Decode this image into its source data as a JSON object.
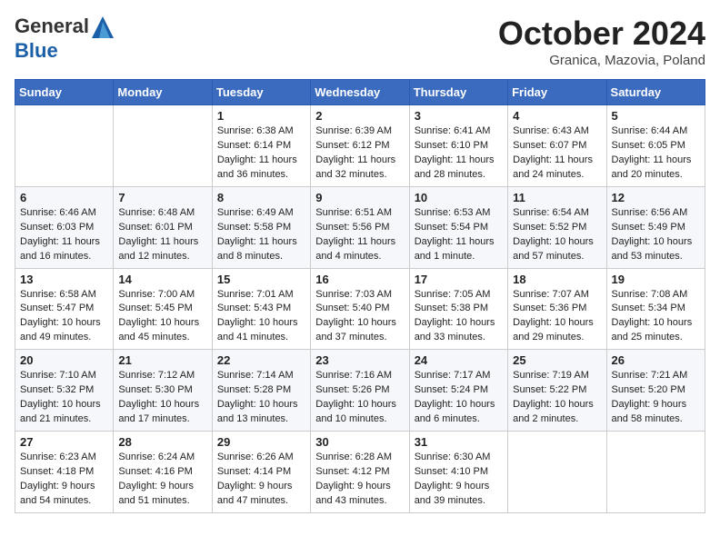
{
  "header": {
    "logo_general": "General",
    "logo_blue": "Blue",
    "month_title": "October 2024",
    "location": "Granica, Mazovia, Poland"
  },
  "days_of_week": [
    "Sunday",
    "Monday",
    "Tuesday",
    "Wednesday",
    "Thursday",
    "Friday",
    "Saturday"
  ],
  "weeks": [
    [
      {
        "day": "",
        "sunrise": "",
        "sunset": "",
        "daylight": ""
      },
      {
        "day": "",
        "sunrise": "",
        "sunset": "",
        "daylight": ""
      },
      {
        "day": "1",
        "sunrise": "Sunrise: 6:38 AM",
        "sunset": "Sunset: 6:14 PM",
        "daylight": "Daylight: 11 hours and 36 minutes."
      },
      {
        "day": "2",
        "sunrise": "Sunrise: 6:39 AM",
        "sunset": "Sunset: 6:12 PM",
        "daylight": "Daylight: 11 hours and 32 minutes."
      },
      {
        "day": "3",
        "sunrise": "Sunrise: 6:41 AM",
        "sunset": "Sunset: 6:10 PM",
        "daylight": "Daylight: 11 hours and 28 minutes."
      },
      {
        "day": "4",
        "sunrise": "Sunrise: 6:43 AM",
        "sunset": "Sunset: 6:07 PM",
        "daylight": "Daylight: 11 hours and 24 minutes."
      },
      {
        "day": "5",
        "sunrise": "Sunrise: 6:44 AM",
        "sunset": "Sunset: 6:05 PM",
        "daylight": "Daylight: 11 hours and 20 minutes."
      }
    ],
    [
      {
        "day": "6",
        "sunrise": "Sunrise: 6:46 AM",
        "sunset": "Sunset: 6:03 PM",
        "daylight": "Daylight: 11 hours and 16 minutes."
      },
      {
        "day": "7",
        "sunrise": "Sunrise: 6:48 AM",
        "sunset": "Sunset: 6:01 PM",
        "daylight": "Daylight: 11 hours and 12 minutes."
      },
      {
        "day": "8",
        "sunrise": "Sunrise: 6:49 AM",
        "sunset": "Sunset: 5:58 PM",
        "daylight": "Daylight: 11 hours and 8 minutes."
      },
      {
        "day": "9",
        "sunrise": "Sunrise: 6:51 AM",
        "sunset": "Sunset: 5:56 PM",
        "daylight": "Daylight: 11 hours and 4 minutes."
      },
      {
        "day": "10",
        "sunrise": "Sunrise: 6:53 AM",
        "sunset": "Sunset: 5:54 PM",
        "daylight": "Daylight: 11 hours and 1 minute."
      },
      {
        "day": "11",
        "sunrise": "Sunrise: 6:54 AM",
        "sunset": "Sunset: 5:52 PM",
        "daylight": "Daylight: 10 hours and 57 minutes."
      },
      {
        "day": "12",
        "sunrise": "Sunrise: 6:56 AM",
        "sunset": "Sunset: 5:49 PM",
        "daylight": "Daylight: 10 hours and 53 minutes."
      }
    ],
    [
      {
        "day": "13",
        "sunrise": "Sunrise: 6:58 AM",
        "sunset": "Sunset: 5:47 PM",
        "daylight": "Daylight: 10 hours and 49 minutes."
      },
      {
        "day": "14",
        "sunrise": "Sunrise: 7:00 AM",
        "sunset": "Sunset: 5:45 PM",
        "daylight": "Daylight: 10 hours and 45 minutes."
      },
      {
        "day": "15",
        "sunrise": "Sunrise: 7:01 AM",
        "sunset": "Sunset: 5:43 PM",
        "daylight": "Daylight: 10 hours and 41 minutes."
      },
      {
        "day": "16",
        "sunrise": "Sunrise: 7:03 AM",
        "sunset": "Sunset: 5:40 PM",
        "daylight": "Daylight: 10 hours and 37 minutes."
      },
      {
        "day": "17",
        "sunrise": "Sunrise: 7:05 AM",
        "sunset": "Sunset: 5:38 PM",
        "daylight": "Daylight: 10 hours and 33 minutes."
      },
      {
        "day": "18",
        "sunrise": "Sunrise: 7:07 AM",
        "sunset": "Sunset: 5:36 PM",
        "daylight": "Daylight: 10 hours and 29 minutes."
      },
      {
        "day": "19",
        "sunrise": "Sunrise: 7:08 AM",
        "sunset": "Sunset: 5:34 PM",
        "daylight": "Daylight: 10 hours and 25 minutes."
      }
    ],
    [
      {
        "day": "20",
        "sunrise": "Sunrise: 7:10 AM",
        "sunset": "Sunset: 5:32 PM",
        "daylight": "Daylight: 10 hours and 21 minutes."
      },
      {
        "day": "21",
        "sunrise": "Sunrise: 7:12 AM",
        "sunset": "Sunset: 5:30 PM",
        "daylight": "Daylight: 10 hours and 17 minutes."
      },
      {
        "day": "22",
        "sunrise": "Sunrise: 7:14 AM",
        "sunset": "Sunset: 5:28 PM",
        "daylight": "Daylight: 10 hours and 13 minutes."
      },
      {
        "day": "23",
        "sunrise": "Sunrise: 7:16 AM",
        "sunset": "Sunset: 5:26 PM",
        "daylight": "Daylight: 10 hours and 10 minutes."
      },
      {
        "day": "24",
        "sunrise": "Sunrise: 7:17 AM",
        "sunset": "Sunset: 5:24 PM",
        "daylight": "Daylight: 10 hours and 6 minutes."
      },
      {
        "day": "25",
        "sunrise": "Sunrise: 7:19 AM",
        "sunset": "Sunset: 5:22 PM",
        "daylight": "Daylight: 10 hours and 2 minutes."
      },
      {
        "day": "26",
        "sunrise": "Sunrise: 7:21 AM",
        "sunset": "Sunset: 5:20 PM",
        "daylight": "Daylight: 9 hours and 58 minutes."
      }
    ],
    [
      {
        "day": "27",
        "sunrise": "Sunrise: 6:23 AM",
        "sunset": "Sunset: 4:18 PM",
        "daylight": "Daylight: 9 hours and 54 minutes."
      },
      {
        "day": "28",
        "sunrise": "Sunrise: 6:24 AM",
        "sunset": "Sunset: 4:16 PM",
        "daylight": "Daylight: 9 hours and 51 minutes."
      },
      {
        "day": "29",
        "sunrise": "Sunrise: 6:26 AM",
        "sunset": "Sunset: 4:14 PM",
        "daylight": "Daylight: 9 hours and 47 minutes."
      },
      {
        "day": "30",
        "sunrise": "Sunrise: 6:28 AM",
        "sunset": "Sunset: 4:12 PM",
        "daylight": "Daylight: 9 hours and 43 minutes."
      },
      {
        "day": "31",
        "sunrise": "Sunrise: 6:30 AM",
        "sunset": "Sunset: 4:10 PM",
        "daylight": "Daylight: 9 hours and 39 minutes."
      },
      {
        "day": "",
        "sunrise": "",
        "sunset": "",
        "daylight": ""
      },
      {
        "day": "",
        "sunrise": "",
        "sunset": "",
        "daylight": ""
      }
    ]
  ]
}
